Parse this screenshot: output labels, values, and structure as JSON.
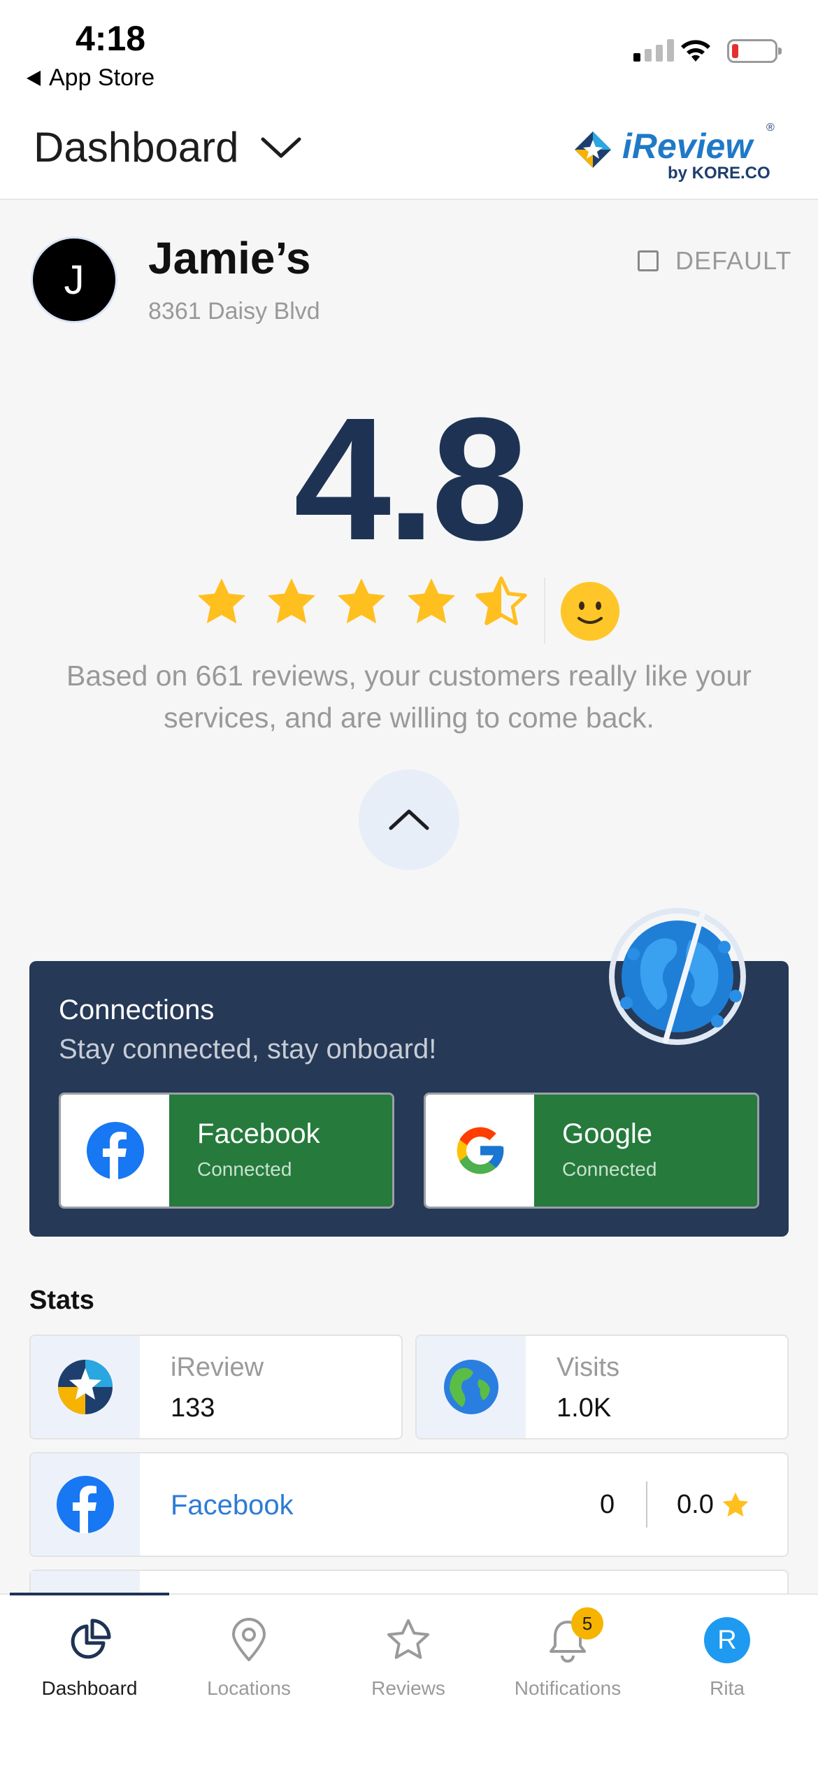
{
  "status_bar": {
    "time": "4:18",
    "back_label": "App Store"
  },
  "header": {
    "title": "Dashboard",
    "brand_name": "iReview",
    "brand_sub": "by KORE.CO",
    "brand_reg": "®"
  },
  "business": {
    "avatar_initial": "J",
    "name": "Jamie’s",
    "address": "8361 Daisy Blvd",
    "default_label": "DEFAULT",
    "default_checked": false
  },
  "rating": {
    "value": "4.8",
    "stars_filled": 4.5,
    "stars_total": 5,
    "description": "Based on 661 reviews, your customers really like your services, and are willing to come back."
  },
  "connections": {
    "title": "Connections",
    "subtitle": "Stay connected, stay onboard!",
    "items": [
      {
        "name": "Facebook",
        "status": "Connected",
        "icon": "facebook-icon"
      },
      {
        "name": "Google",
        "status": "Connected",
        "icon": "google-icon"
      }
    ]
  },
  "stats": {
    "title": "Stats",
    "ireview": {
      "label": "iReview",
      "value": "133"
    },
    "visits": {
      "label": "Visits",
      "value": "1.0K"
    },
    "facebook": {
      "label": "Facebook",
      "count": "0",
      "rating": "0.0"
    }
  },
  "tabs": [
    {
      "label": "Dashboard",
      "icon": "pie-chart-icon",
      "active": true
    },
    {
      "label": "Locations",
      "icon": "map-pin-icon",
      "active": false
    },
    {
      "label": "Reviews",
      "icon": "star-icon",
      "active": false
    },
    {
      "label": "Notifications",
      "icon": "bell-icon",
      "active": false,
      "badge": "5"
    },
    {
      "label": "Rita",
      "icon": "avatar",
      "active": false,
      "initial": "R"
    }
  ],
  "colors": {
    "primary_navy": "#1e3354",
    "connections_bg": "#263956",
    "connected_green": "#257a3c",
    "star_yellow": "#ffbf1f",
    "link_blue": "#2d7bd4"
  }
}
